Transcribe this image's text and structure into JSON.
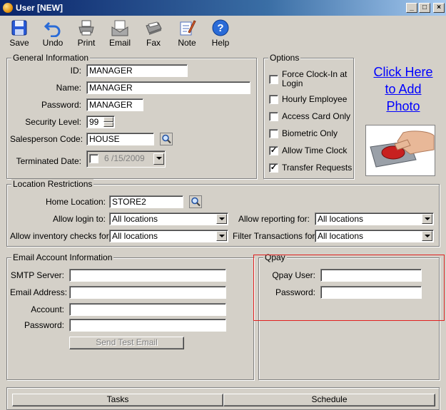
{
  "window": {
    "title": "User [NEW]",
    "minimize": "_",
    "maximize": "□",
    "close": "×"
  },
  "toolbar": {
    "save": "Save",
    "undo": "Undo",
    "print": "Print",
    "email": "Email",
    "fax": "Fax",
    "note": "Note",
    "help": "Help"
  },
  "general": {
    "legend": "General Information",
    "id_label": "ID:",
    "id_value": "MANAGER",
    "name_label": "Name:",
    "name_value": "MANAGER",
    "password_label": "Password:",
    "password_value": "MANAGER",
    "security_label": "Security Level:",
    "security_value": "99",
    "salesperson_label": "Salesperson Code:",
    "salesperson_value": "HOUSE",
    "terminated_label": "Terminated Date:",
    "terminated_value": "6 /15/2009"
  },
  "options": {
    "legend": "Options",
    "items": [
      {
        "label": "Force Clock-In at",
        "label2": "Login",
        "checked": false
      },
      {
        "label": "Hourly Employee",
        "checked": false
      },
      {
        "label": "Access Card Only",
        "checked": false
      },
      {
        "label": "Biometric Only",
        "checked": false
      },
      {
        "label": "Allow Time Clock",
        "checked": true
      },
      {
        "label": "Transfer Requests",
        "checked": true
      }
    ]
  },
  "photo": {
    "line1": "Click Here",
    "line2": "to Add",
    "line3": "Photo"
  },
  "location": {
    "legend": "Location Restrictions",
    "home_label": "Home Location:",
    "home_value": "STORE2",
    "login_label": "Allow login to:",
    "login_value": "All locations",
    "reporting_label": "Allow reporting for:",
    "reporting_value": "All locations",
    "inventory_label": "Allow inventory checks for:",
    "inventory_value": "All locations",
    "filter_label": "Filter Transactions for:",
    "filter_value": "All locations"
  },
  "email": {
    "legend": "Email Account Information",
    "smtp_label": "SMTP Server:",
    "smtp_value": "",
    "address_label": "Email Address:",
    "address_value": "",
    "account_label": "Account:",
    "account_value": "",
    "password_label": "Password:",
    "password_value": "",
    "send_test": "Send Test Email"
  },
  "qpay": {
    "legend": "Qpay",
    "user_label": "Qpay User:",
    "user_value": "",
    "password_label": "Password:",
    "password_value": ""
  },
  "bottom": {
    "tasks": "Tasks",
    "schedule": "Schedule"
  }
}
